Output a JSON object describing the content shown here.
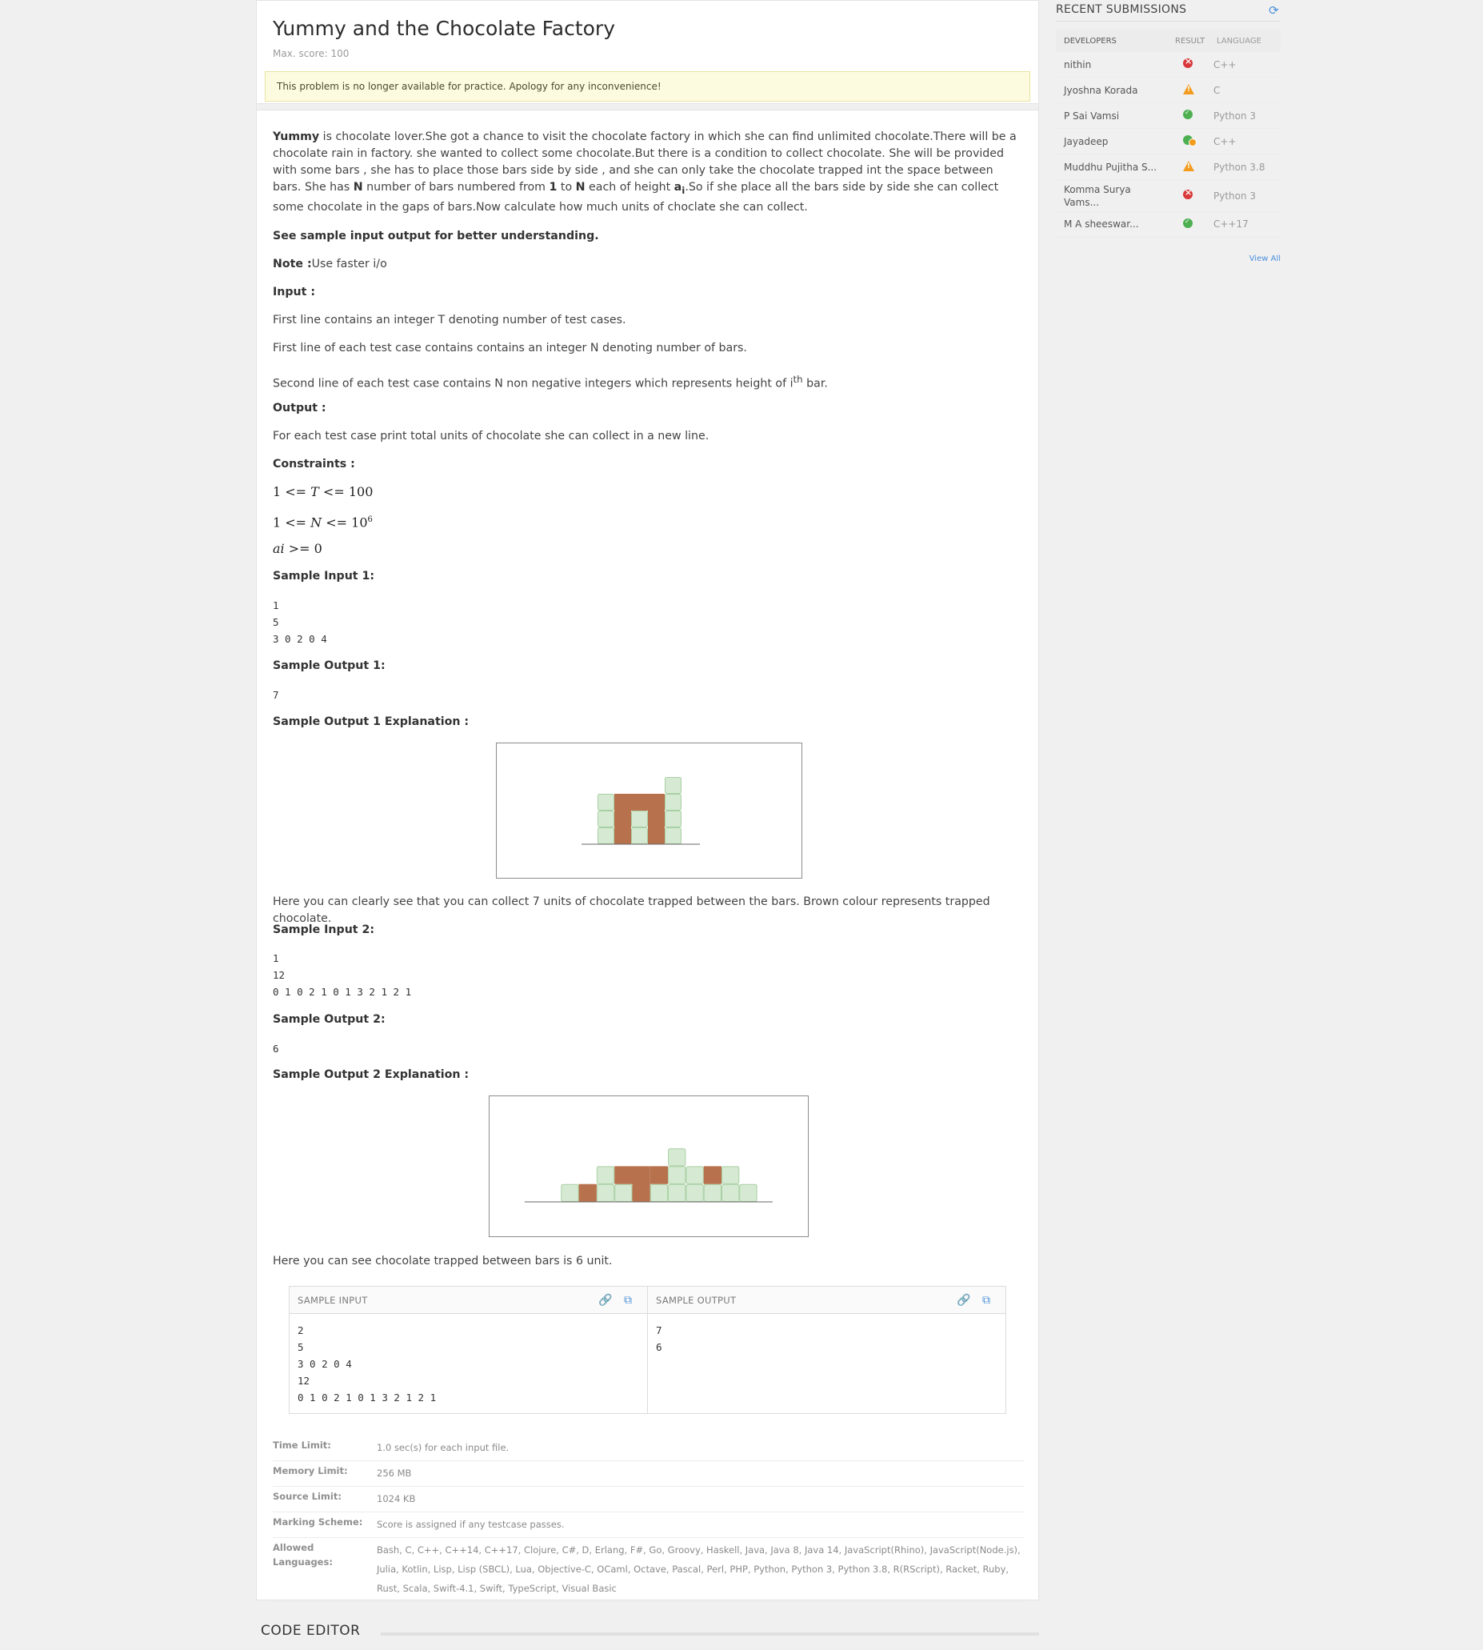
{
  "problem": {
    "title": "Yummy and the Chocolate Factory",
    "max_score": "Max. score: 100",
    "notice": "This problem is no longer available for practice. Apology for any inconvenience!"
  },
  "statement": {
    "intro_name": "Yummy",
    "intro_p1": " is chocolate lover.She got a chance to visit the chocolate factory in which she can find unlimited chocolate.There will be a chocolate rain in factory. she wanted to collect some chocolate.But there is a condition to collect chocolate. She will be provided with some bars , she has to place those bars side by side , and she can only take the chocolate trapped int the space between bars. She has ",
    "intro_N1": "N",
    "intro_p2": " number of bars numbered from ",
    "intro_one": "1",
    "intro_to": " to ",
    "intro_N2": "N",
    "intro_p3": " each of height ",
    "intro_a": "a",
    "intro_i": "i",
    "intro_p4": ".So if she place all the bars side by side she can collect  some chocolate in the gaps of bars.Now calculate how much units of choclate she can collect.",
    "see_sample": "See sample input output  for better understanding.",
    "note_label": "Note :",
    "note_text": "Use faster i/o",
    "input_label": "Input :",
    "input_line1": "First line contains an integer T denoting number of test cases.",
    "input_line2": "First line of each test case contains contains an integer N denoting number of bars.",
    "input_line3_a": "Second line of each test case contains N non negative integers which represents height of i",
    "input_line3_sup": "th",
    "input_line3_b": "  bar.",
    "output_label": "Output :",
    "output_text": "For each test case print total units of chocolate she can collect in a new line.",
    "constraints_label": "Constraints :",
    "c1_a": "1 <= ",
    "c1_var": "T",
    "c1_b": " <= 100",
    "c2_a": "1 <= ",
    "c2_var": "N",
    "c2_b": " <= 10",
    "c2_sup": "6",
    "c3_var": "ai",
    "c3_b": " >= 0",
    "si1_label": "Sample Input 1:",
    "si1_lines": [
      "1",
      "5",
      "3 0 2 0 4"
    ],
    "so1_label": "Sample Output 1:",
    "so1_value": "7",
    "so1_expl_label": "Sample Output 1 Explanation :",
    "so1_expl_text": "Here you can clearly see that you can collect 7 units of chocolate trapped between the bars. Brown colour represents trapped chocolate.",
    "si2_label": "Sample Input 2:",
    "si2_lines": [
      "1",
      "12",
      "0 1 0 2 1 0 1 3 2 1 2 1"
    ],
    "so2_label": "Sample Output 2:",
    "so2_value": "6",
    "so2_expl_label": "Sample Output 2 Explanation :",
    "so2_expl_text": "Here you can see chocolate trapped between bars is 6 unit."
  },
  "figures": {
    "fig1": {
      "bars": [
        3,
        0,
        2,
        0,
        4
      ],
      "water": [
        0,
        3,
        1,
        3,
        0
      ]
    },
    "fig2": {
      "bars": [
        0,
        1,
        0,
        2,
        1,
        0,
        1,
        3,
        2,
        1,
        2,
        1
      ],
      "water": [
        0,
        0,
        1,
        0,
        1,
        2,
        1,
        0,
        0,
        1,
        0,
        0
      ]
    },
    "colors": {
      "bar": "#d6ead3",
      "bar_stroke": "#a9cfa4",
      "chocolate": "#b8714d",
      "ground": "#666666"
    }
  },
  "sample_io": {
    "input_label": "SAMPLE INPUT",
    "output_label": "SAMPLE OUTPUT",
    "input_lines": [
      "2",
      "5",
      "3 0 2 0 4",
      "12",
      "0 1 0 2 1 0 1 3 2 1 2 1"
    ],
    "output_lines": [
      "7",
      "6"
    ]
  },
  "limits": [
    {
      "key": "Time Limit:",
      "value": "1.0 sec(s) for each input file."
    },
    {
      "key": "Memory Limit:",
      "value": "256 MB"
    },
    {
      "key": "Source Limit:",
      "value": "1024 KB"
    },
    {
      "key": "Marking Scheme:",
      "value": "Score is assigned if any testcase passes."
    },
    {
      "key": "Allowed Languages:",
      "value": "Bash, C, C++, C++14, C++17, Clojure, C#, D, Erlang, F#, Go, Groovy, Haskell, Java, Java 8, Java 14, JavaScript(Rhino), JavaScript(Node.js), Julia, Kotlin, Lisp, Lisp (SBCL), Lua, Objective-C, OCaml, Octave, Pascal, Perl, PHP, Python, Python 3, Python 3.8, R(RScript), Racket, Ruby, Rust, Scala, Swift-4.1, Swift, TypeScript, Visual Basic"
    }
  ],
  "code_editor": {
    "title": "CODE EDITOR"
  },
  "recent": {
    "title": "RECENT SUBMISSIONS",
    "col_dev": "DEVELOPERS",
    "col_result": "RESULT",
    "col_lang": "LANGUAGE",
    "rows": [
      {
        "dev": "nithin",
        "result": "wrong",
        "lang": "C++"
      },
      {
        "dev": "Jyoshna Korada",
        "result": "error",
        "lang": "C"
      },
      {
        "dev": "P Sai Vamsi",
        "result": "accepted",
        "lang": "Python 3"
      },
      {
        "dev": "Jayadeep",
        "result": "partial",
        "lang": "C++"
      },
      {
        "dev": "Muddhu Pujitha S...",
        "result": "error",
        "lang": "Python 3.8"
      },
      {
        "dev": "Komma Surya Vams...",
        "result": "wrong",
        "lang": "Python 3"
      },
      {
        "dev": "M A sheeswar...",
        "result": "accepted",
        "lang": "C++17"
      }
    ],
    "view_all": "View All"
  }
}
